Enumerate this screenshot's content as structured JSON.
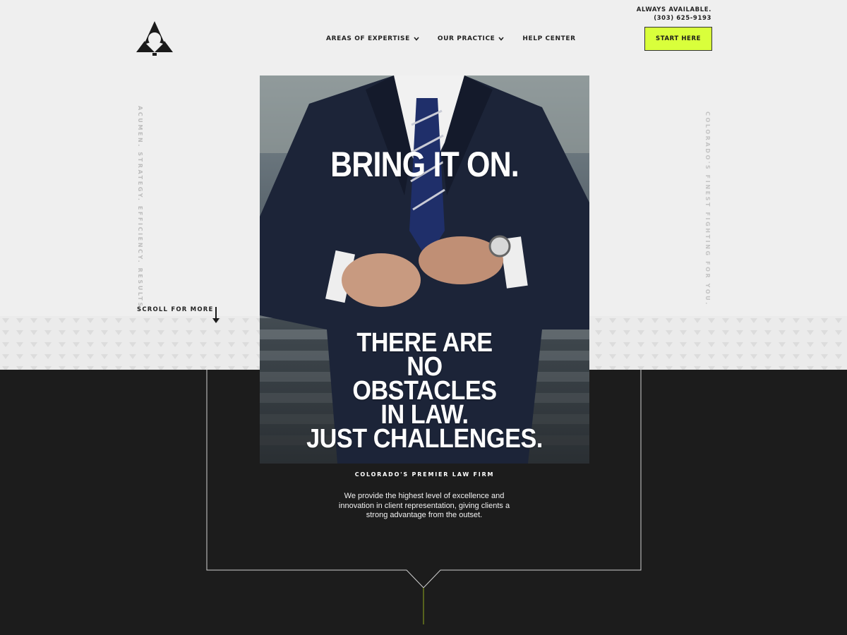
{
  "header": {
    "logo_name": "firm-logo",
    "nav": [
      {
        "label": "AREAS OF EXPERTISE",
        "has_dropdown": true
      },
      {
        "label": "OUR PRACTICE",
        "has_dropdown": true
      },
      {
        "label": "HELP CENTER",
        "has_dropdown": false
      }
    ],
    "availability_line1": "ALWAYS AVAILABLE.",
    "phone": "(303) 625-9193",
    "cta_label": "START HERE"
  },
  "side": {
    "left_text": "ACUMEN. STRATEGY. EFFICIENCY. RESULTS.",
    "right_text": "COLORADO'S FINEST FIGHTING FOR YOU."
  },
  "scroll": {
    "label": "SCROLL FOR MORE"
  },
  "hero": {
    "headline": "BRING IT ON.",
    "tagline_lines": [
      "THERE ARE",
      "NO",
      "OBSTACLES",
      "IN LAW.",
      "JUST CHALLENGES."
    ]
  },
  "intro": {
    "subheading": "COLORADO'S PREMIER LAW FIRM",
    "description": "We provide the highest level of excellence and innovation in client representation, giving clients a strong advantage from the outset."
  },
  "colors": {
    "accent": "#d9ff3b",
    "light_bg": "#efefef",
    "dark_bg": "#1c1c1c",
    "accent_line": "#8fa81e"
  }
}
